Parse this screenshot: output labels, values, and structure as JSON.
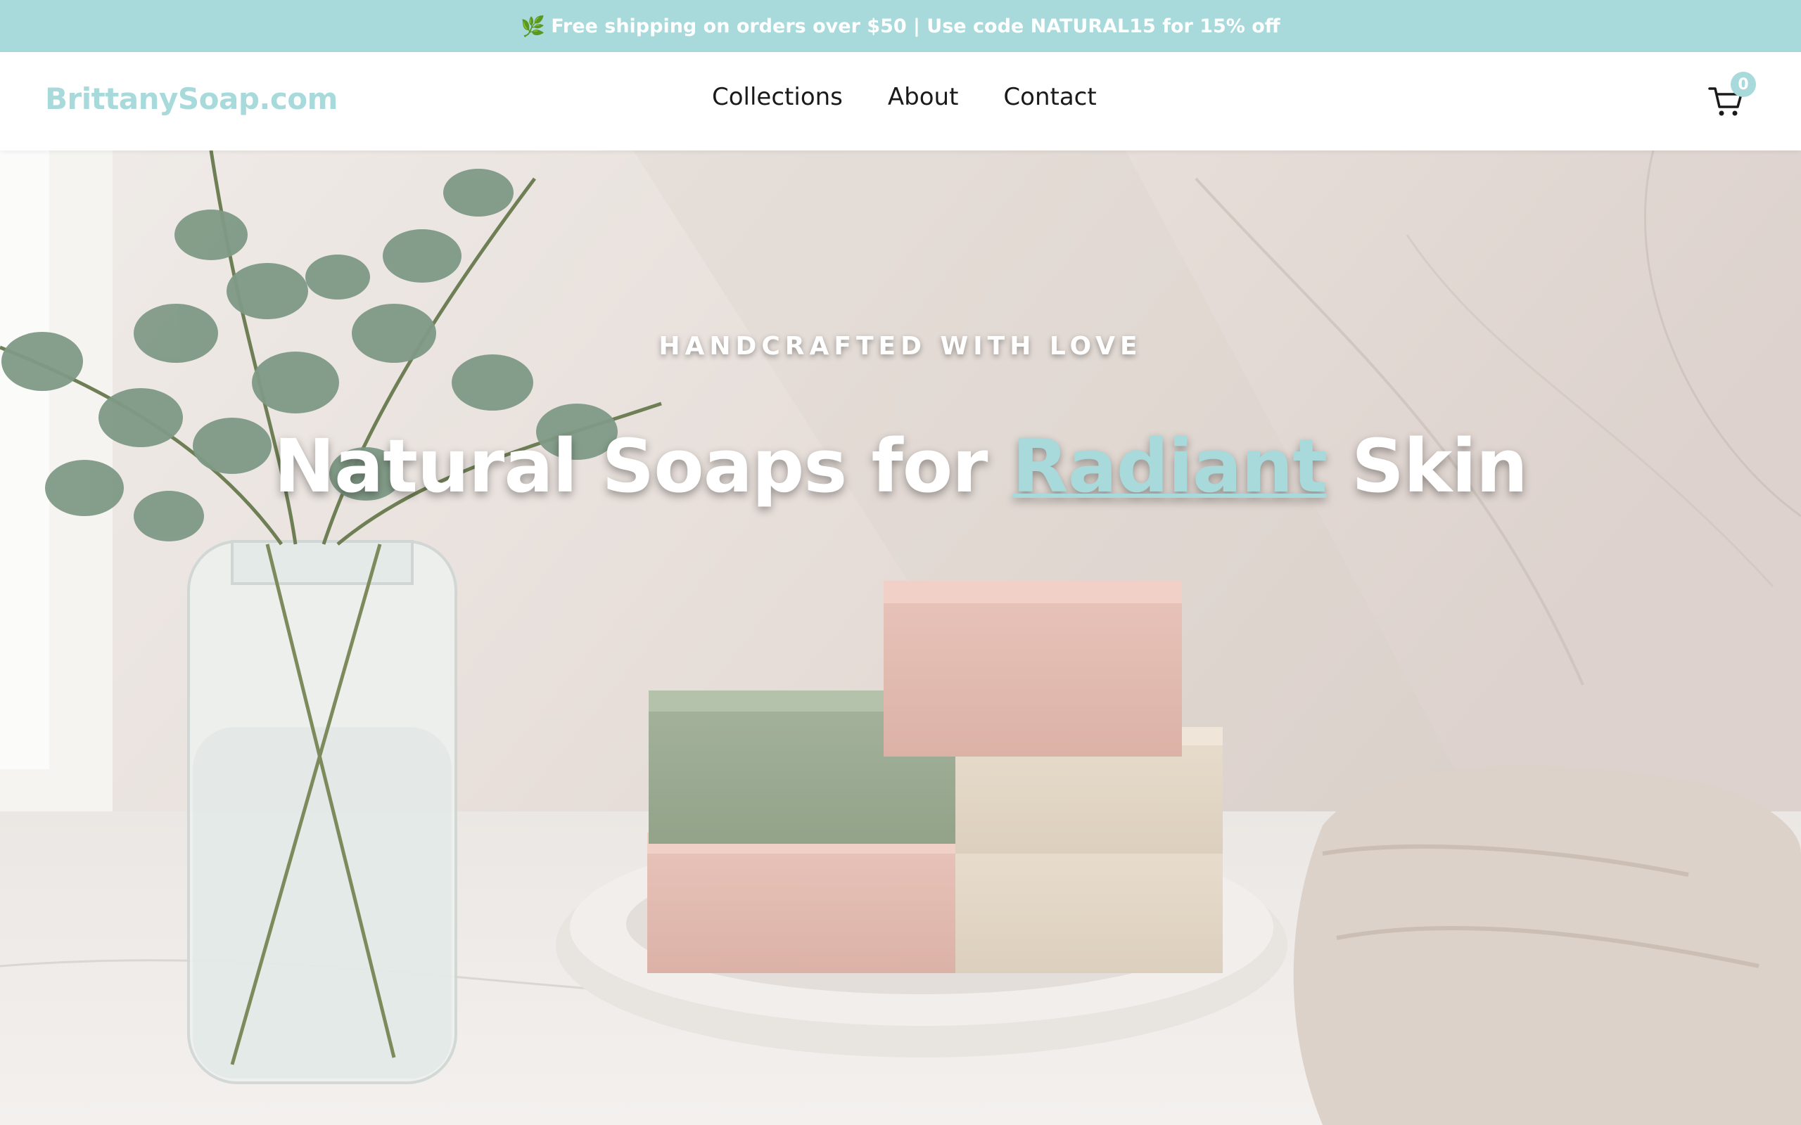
{
  "promo": {
    "icon": "leaf-icon",
    "text": "Free shipping on orders over $50 | Use code NATURAL15 for 15% off"
  },
  "header": {
    "logo": "BrittanySoap.com",
    "nav": [
      {
        "label": "Collections"
      },
      {
        "label": "About"
      },
      {
        "label": "Contact"
      }
    ],
    "cart": {
      "icon": "cart-icon",
      "count": "0"
    }
  },
  "hero": {
    "tagline": "HANDCRAFTED WITH LOVE",
    "title_before": "Natural Soaps for",
    "title_accent": "Radiant",
    "title_after": "Skin",
    "image": "soap-bars-eucalyptus-photo"
  },
  "colors": {
    "accent": "#a8d9db",
    "nav_text": "#1a1a1a",
    "hero_text": "#ffffff"
  }
}
